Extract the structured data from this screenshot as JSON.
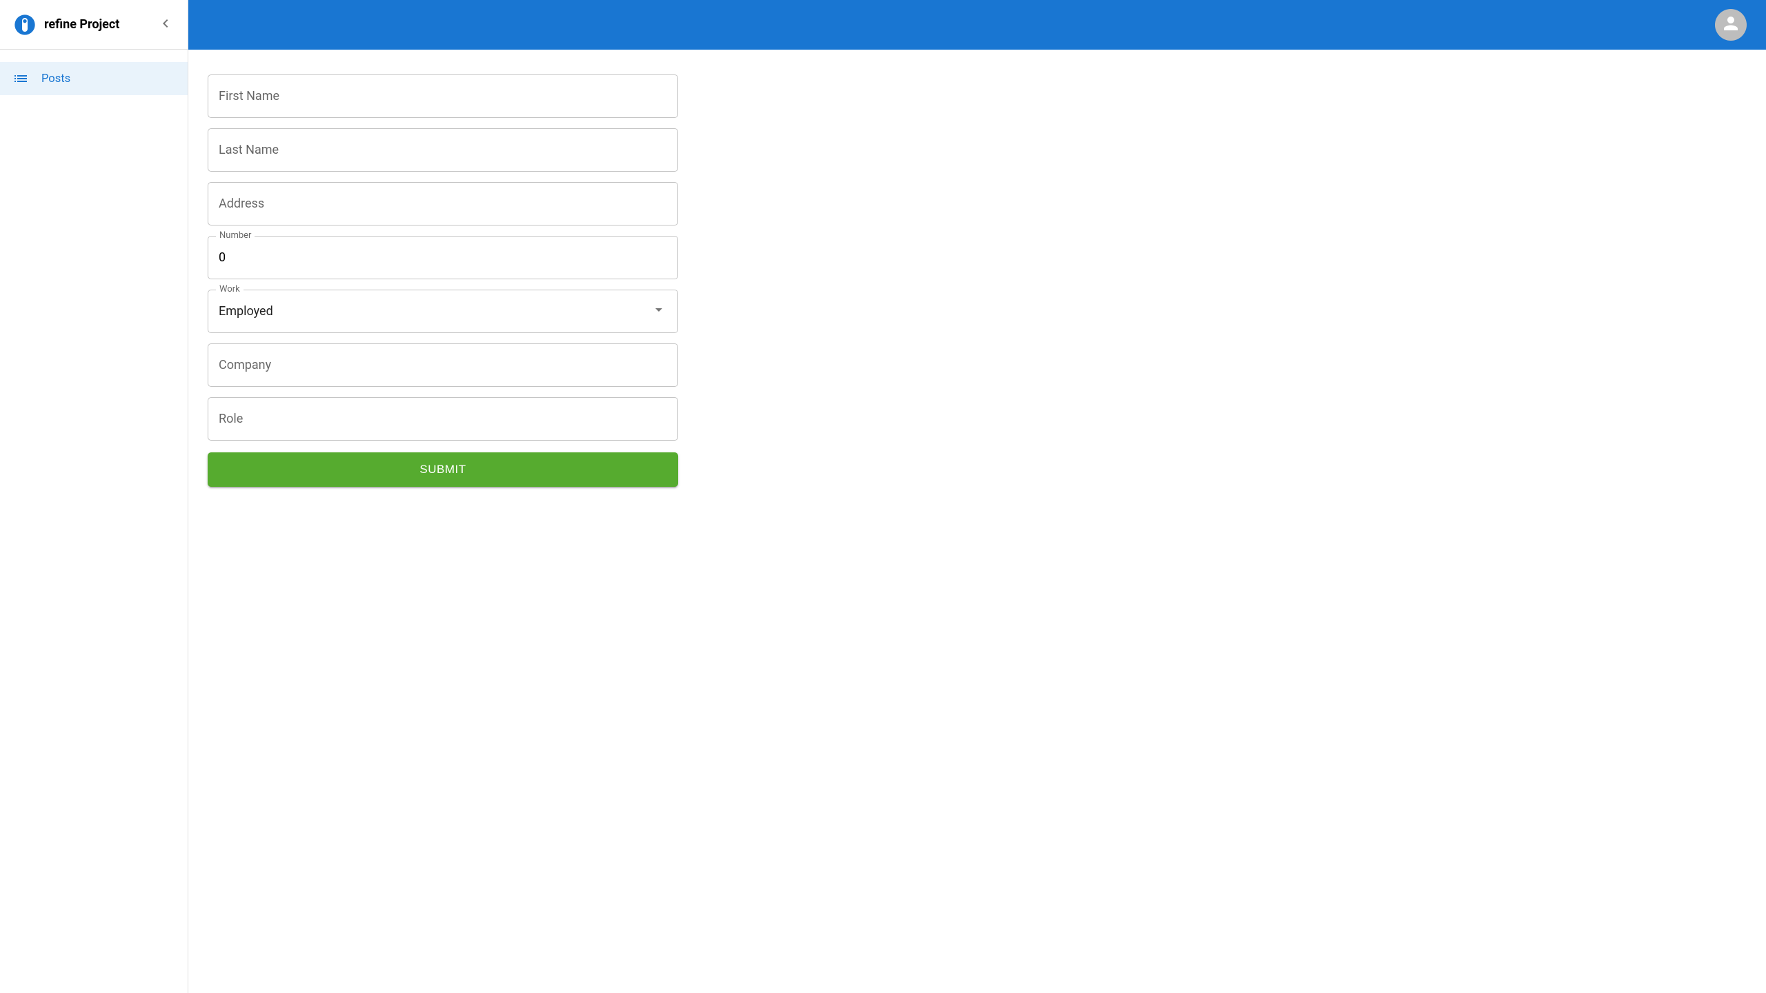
{
  "sidebar": {
    "title": "refine Project",
    "items": [
      {
        "label": "Posts"
      }
    ]
  },
  "form": {
    "firstName": {
      "label": "First Name",
      "value": ""
    },
    "lastName": {
      "label": "Last Name",
      "value": ""
    },
    "address": {
      "label": "Address",
      "value": ""
    },
    "number": {
      "label": "Number",
      "value": "0"
    },
    "work": {
      "label": "Work",
      "value": "Employed"
    },
    "company": {
      "label": "Company",
      "value": ""
    },
    "role": {
      "label": "Role",
      "value": ""
    },
    "submit": "SUBMIT"
  }
}
